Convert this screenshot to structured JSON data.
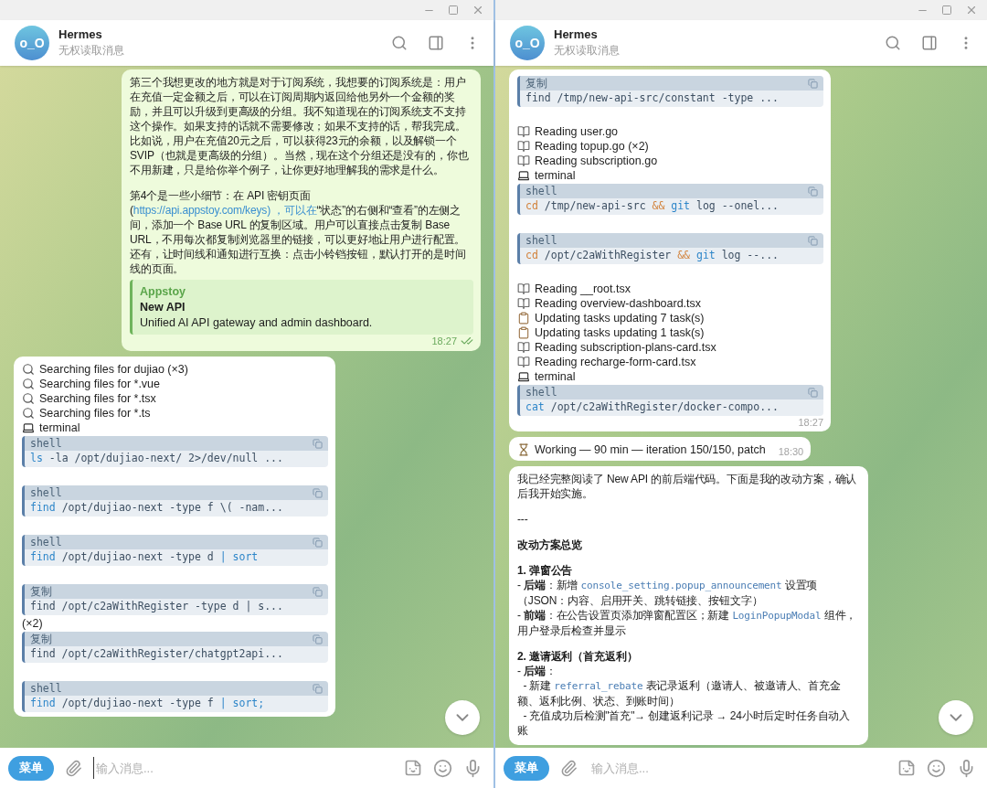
{
  "windows": [
    {
      "title": "Hermes",
      "subtitle": "无权读取消息",
      "avatar_text": "o_O",
      "menu_button": "菜单",
      "input": {
        "placeholder": "输入消息...",
        "focused": true
      },
      "messages": [
        {
          "kind": "outgoing",
          "time": "18:27",
          "read": true,
          "blocks": [
            {
              "kind": "paragraph",
              "segments": [
                {
                  "kind": "text",
                  "text": "第三个我想更改的地方就是对于订阅系统，我想要的订阅系统是：用户在充值一定金额之后，可以在订阅周期内返回给他另外一个金额的奖励，并且可以升级到更高级的分组。我不知道现在的订阅系统支不支持这个操作。如果支持的话就不需要修改；如果不支持的话，帮我完成。比如说，用户在充值20元之后，可以获得23元的余额，以及解锁一个SVIP（也就是更高级的分组）。当然，现在这个分组还是没有的，你也不用新建，只是给你举个例子，让你更好地理解我的需求是什么。"
                }
              ]
            },
            {
              "kind": "paragraph",
              "segments": [
                {
                  "kind": "text",
                  "text": "第4个是一些小细节：在 API 密钥页面 ("
                },
                {
                  "kind": "link",
                  "text": "https://api.appstoy.com/keys) ，可以在"
                },
                {
                  "kind": "text",
                  "text": "“状态”的右侧和“查看”的左侧之间，添加一个 Base URL 的复制区域。用户可以直接点击复制 Base URL，不用每次都复制浏览器里的链接，可以更好地让用户进行配置。还有，让时间线和通知进行互换：点击小铃铛按钮，默认打开的是时间线的页面。"
                }
              ]
            },
            {
              "kind": "preview",
              "site": "Appstoy",
              "title": "New API",
              "description": "Unified AI API gateway and admin dashboard."
            }
          ]
        },
        {
          "kind": "incoming",
          "blocks": [
            {
              "kind": "search",
              "text": "Searching files for dujiao (×3)"
            },
            {
              "kind": "search",
              "text": "Searching files for *.vue"
            },
            {
              "kind": "search",
              "text": "Searching files for *.tsx"
            },
            {
              "kind": "search",
              "text": "Searching files for *.ts"
            },
            {
              "kind": "terminal",
              "text": "terminal"
            },
            {
              "kind": "code",
              "label": "shell",
              "tokens": [
                {
                  "kind": "keyword",
                  "text": "ls"
                },
                {
                  "kind": "plain",
                  "text": " -la /opt/dujiao-next/ 2>/dev/null ..."
                }
              ]
            },
            {
              "kind": "code",
              "label": "shell",
              "tokens": [
                {
                  "kind": "keyword",
                  "text": "find"
                },
                {
                  "kind": "plain",
                  "text": " /opt/dujiao-next -type f \\( -nam..."
                }
              ]
            },
            {
              "kind": "code",
              "label": "shell",
              "tokens": [
                {
                  "kind": "keyword",
                  "text": "find"
                },
                {
                  "kind": "plain",
                  "text": " /opt/dujiao-next -type d "
                },
                {
                  "kind": "keyword",
                  "text": "| sort"
                }
              ]
            },
            {
              "kind": "code",
              "label": "复制",
              "tokens": [
                {
                  "kind": "plain",
                  "text": "find /opt/c2aWithRegister -type d | s..."
                }
              ]
            },
            {
              "kind": "note",
              "text": "(×2)"
            },
            {
              "kind": "code",
              "label": "复制",
              "tokens": [
                {
                  "kind": "plain",
                  "text": "find /opt/c2aWithRegister/chatgpt2api..."
                }
              ]
            },
            {
              "kind": "code",
              "label": "shell",
              "tokens": [
                {
                  "kind": "keyword",
                  "text": "find"
                },
                {
                  "kind": "plain",
                  "text": " /opt/dujiao-next -type f "
                },
                {
                  "kind": "keyword",
                  "text": "| sort;"
                }
              ]
            }
          ]
        }
      ]
    },
    {
      "title": "Hermes",
      "subtitle": "无权读取消息",
      "avatar_text": "o_O",
      "menu_button": "菜单",
      "input": {
        "placeholder": "输入消息...",
        "focused": false
      },
      "messages": [
        {
          "kind": "incoming",
          "time": "18:27",
          "blocks": [
            {
              "kind": "code",
              "label": "复制",
              "tokens": [
                {
                  "kind": "plain",
                  "text": "find /tmp/new-api-src/constant -type ..."
                }
              ]
            },
            {
              "kind": "read",
              "text": "Reading user.go"
            },
            {
              "kind": "read",
              "text": "Reading topup.go (×2)"
            },
            {
              "kind": "read",
              "text": "Reading subscription.go"
            },
            {
              "kind": "terminal",
              "text": "terminal"
            },
            {
              "kind": "code",
              "label": "shell",
              "tokens": [
                {
                  "kind": "builtin",
                  "text": "cd"
                },
                {
                  "kind": "plain",
                  "text": " /tmp/new-api-src "
                },
                {
                  "kind": "builtin",
                  "text": "&& "
                },
                {
                  "kind": "keyword",
                  "text": "git"
                },
                {
                  "kind": "plain",
                  "text": " log --onel..."
                }
              ]
            },
            {
              "kind": "code",
              "label": "shell",
              "tokens": [
                {
                  "kind": "builtin",
                  "text": "cd"
                },
                {
                  "kind": "plain",
                  "text": " /opt/c2aWithRegister "
                },
                {
                  "kind": "builtin",
                  "text": "&& "
                },
                {
                  "kind": "keyword",
                  "text": "git"
                },
                {
                  "kind": "plain",
                  "text": " log --..."
                }
              ]
            },
            {
              "kind": "read",
              "text": "Reading __root.tsx"
            },
            {
              "kind": "read",
              "text": "Reading overview-dashboard.tsx"
            },
            {
              "kind": "task",
              "text": "Updating tasks updating 7 task(s)"
            },
            {
              "kind": "task",
              "text": "Updating tasks updating 1 task(s)"
            },
            {
              "kind": "read",
              "text": "Reading subscription-plans-card.tsx"
            },
            {
              "kind": "read",
              "text": "Reading recharge-form-card.tsx"
            },
            {
              "kind": "terminal",
              "text": "terminal"
            },
            {
              "kind": "code",
              "label": "shell",
              "tokens": [
                {
                  "kind": "keyword",
                  "text": "cat"
                },
                {
                  "kind": "plain",
                  "text": " /opt/c2aWithRegister/docker-compo..."
                }
              ]
            }
          ]
        },
        {
          "kind": "incoming",
          "time": "18:30",
          "blocks": [
            {
              "kind": "status",
              "text": "Working — 90 min — iteration 150/150, patch"
            }
          ]
        },
        {
          "kind": "incoming",
          "blocks": [
            {
              "kind": "paragraph",
              "segments": [
                {
                  "kind": "text",
                  "text": "我已经完整阅读了 New API 的前后端代码。下面是我的改动方案，确认后我开始实施。"
                }
              ]
            },
            {
              "kind": "paragraph",
              "segments": [
                {
                  "kind": "text",
                  "text": "---"
                }
              ]
            },
            {
              "kind": "paragraph",
              "segments": [
                {
                  "kind": "bold",
                  "text": "改动方案总览"
                }
              ]
            },
            {
              "kind": "paragraph",
              "segments": [
                {
                  "kind": "bold",
                  "text": "1. 弹窗公告"
                },
                {
                  "kind": "text",
                  "text": "\n- "
                },
                {
                  "kind": "bold",
                  "text": "后端"
                },
                {
                  "kind": "text",
                  "text": "：新增 "
                },
                {
                  "kind": "code",
                  "text": "console_setting.popup_announcement"
                },
                {
                  "kind": "text",
                  "text": " 设置项（JSON：内容、启用开关、跳转链接、按钮文字）\n- "
                },
                {
                  "kind": "bold",
                  "text": "前端"
                },
                {
                  "kind": "text",
                  "text": "：在公告设置页添加弹窗配置区；新建 "
                },
                {
                  "kind": "code",
                  "text": "LoginPopupModal"
                },
                {
                  "kind": "text",
                  "text": " 组件，用户登录后检查并显示"
                }
              ]
            },
            {
              "kind": "paragraph",
              "segments": [
                {
                  "kind": "bold",
                  "text": "2. 邀请返利（首充返利）"
                },
                {
                  "kind": "text",
                  "text": "\n- "
                },
                {
                  "kind": "bold",
                  "text": "后端"
                },
                {
                  "kind": "text",
                  "text": "：\n  - 新建 "
                },
                {
                  "kind": "code",
                  "text": "referral_rebate"
                },
                {
                  "kind": "text",
                  "text": " 表记录返利（邀请人、被邀请人、首充金额、返利比例、状态、到账时间）\n  - 充值成功后检测\"首充\"→ 创建返利记录 → 24小时后定时任务自动入账"
                }
              ]
            }
          ]
        }
      ]
    }
  ]
}
